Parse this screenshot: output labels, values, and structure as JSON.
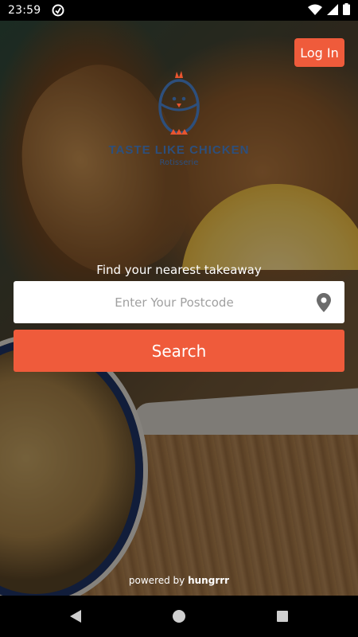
{
  "status_bar": {
    "time": "23:59",
    "icons": [
      "app-status-icon",
      "wifi-icon",
      "signal-icon",
      "battery-icon"
    ]
  },
  "header": {
    "login_label": "Log In"
  },
  "logo": {
    "brand": "TASTE LIKE CHICKEN",
    "sub": "Rotisserie"
  },
  "search": {
    "prompt": "Find your nearest takeaway",
    "placeholder": "Enter Your Postcode",
    "value": "",
    "button_label": "Search"
  },
  "footer": {
    "powered_by": "powered by",
    "brand": "hungrrr"
  },
  "nav_bar": {
    "icons": [
      "back-icon",
      "home-icon",
      "recents-icon"
    ]
  },
  "colors": {
    "accent": "#ef5b3b",
    "logo": "#2d4f7c"
  }
}
